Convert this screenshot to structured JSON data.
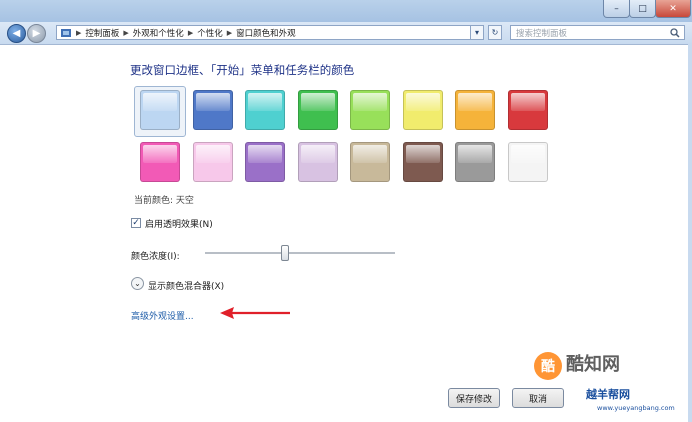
{
  "window": {
    "caption_minimize": "–",
    "caption_maximize": "□",
    "caption_close": "✕"
  },
  "nav": {
    "back_glyph": "◀",
    "forward_glyph": "▶",
    "breadcrumb": [
      "控制面板",
      "外观和个性化",
      "个性化",
      "窗口颜色和外观"
    ],
    "search_placeholder": "搜索控制面板",
    "refresh_glyph": "↻"
  },
  "main": {
    "title": "更改窗口边框、「开始」菜单和任务栏的颜色",
    "current_color_label": "当前颜色: 天空",
    "transparency_label": "启用透明效果(N)",
    "transparency_checked": true,
    "intensity_label": "颜色浓度(I):",
    "intensity_value": 0.42,
    "mixer_label": "显示颜色混合器(X)",
    "advanced_link": "高级外观设置..."
  },
  "swatches": [
    {
      "name": "sky",
      "color": "#bcd6f2",
      "selected": true
    },
    {
      "name": "twilight",
      "color": "#4f78c8"
    },
    {
      "name": "sea",
      "color": "#4fd0d0"
    },
    {
      "name": "leaf",
      "color": "#3fbf4f"
    },
    {
      "name": "lime",
      "color": "#98e05a"
    },
    {
      "name": "lightning",
      "color": "#f1ec6d"
    },
    {
      "name": "pumpkin",
      "color": "#f5b33a"
    },
    {
      "name": "ruby",
      "color": "#d8393d"
    },
    {
      "name": "fuchsia",
      "color": "#f25ab6"
    },
    {
      "name": "blush",
      "color": "#f7c8ea"
    },
    {
      "name": "violet",
      "color": "#9a70c8"
    },
    {
      "name": "lavender",
      "color": "#d8c2e2"
    },
    {
      "name": "taupe",
      "color": "#c8b99a"
    },
    {
      "name": "chocolate",
      "color": "#7e5a50"
    },
    {
      "name": "slate",
      "color": "#9a9a9a"
    },
    {
      "name": "frost",
      "color": "#f4f4f4"
    }
  ],
  "footer": {
    "save_label": "保存修改",
    "cancel_label": "取消"
  },
  "watermark": {
    "badge": "酷",
    "main": "酷知网",
    "site": "越羊帮网",
    "url": "www.yueyangbang.com"
  },
  "colors": {
    "title_blue": "#1e3287",
    "link_blue": "#1e5ca8",
    "arrow_red": "#e0202a"
  }
}
